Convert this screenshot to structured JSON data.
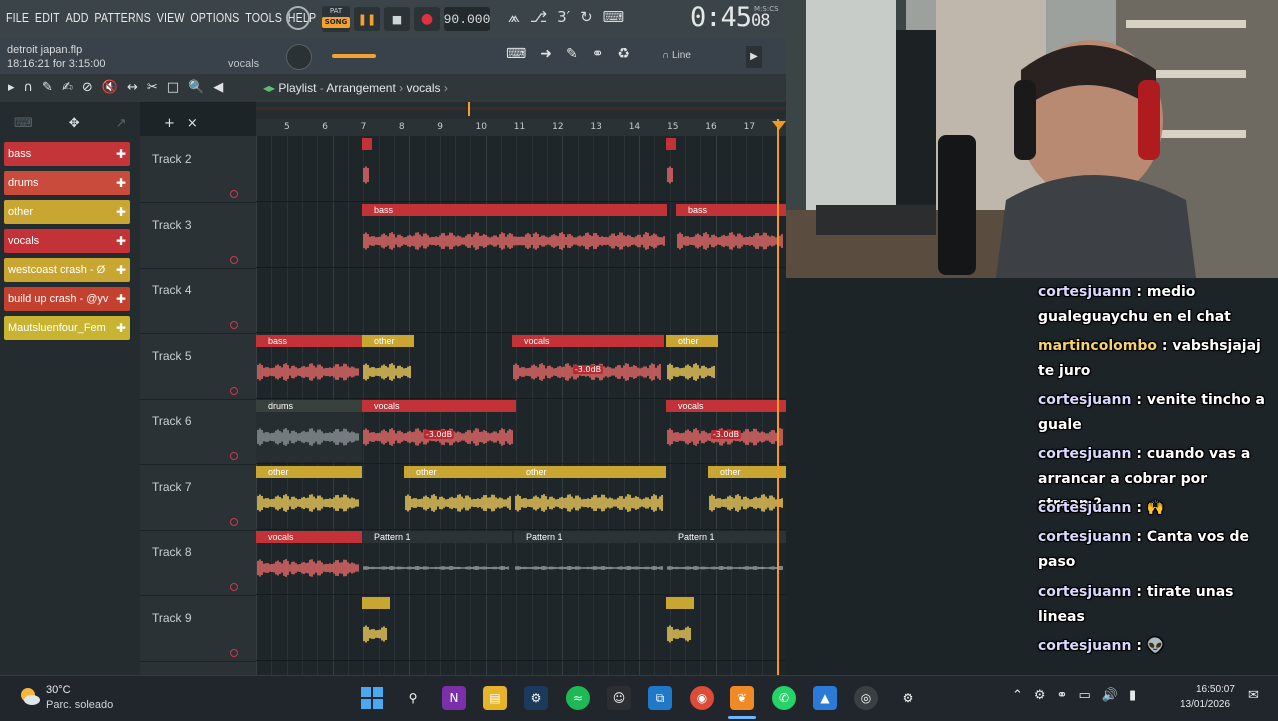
{
  "menu": [
    "FILE",
    "EDIT",
    "ADD",
    "PATTERNS",
    "VIEW",
    "OPTIONS",
    "TOOLS",
    "HELP"
  ],
  "transport": {
    "mode_pat": "PAT",
    "mode_song": "SONG",
    "tempo": "90.000",
    "time_main": "0:45",
    "time_sub": "08",
    "time_unit": "M:S:CS"
  },
  "file_info": {
    "project_name": "detroit japan.flp",
    "time_info": "18:16:21 for 3:15:00",
    "hint": "vocals"
  },
  "snap": "Line",
  "breadcrumb": {
    "root": "Playlist",
    "section": "Arrangement",
    "current": "vocals"
  },
  "clip_picker": [
    {
      "label": "bass",
      "color": "#c4353a"
    },
    {
      "label": "drums",
      "color": "#c94b3b"
    },
    {
      "label": "other",
      "color": "#c9a632"
    },
    {
      "label": "vocals",
      "color": "#c23236"
    },
    {
      "label": "westcoast crash - Ø",
      "color": "#c9a632"
    },
    {
      "label": "build up crash - @yv",
      "color": "#c4412f"
    },
    {
      "label": "Mautsluenfour_Fem",
      "color": "#c9b431"
    }
  ],
  "tracks": [
    "Track 2",
    "Track 3",
    "Track 4",
    "Track 5",
    "Track 6",
    "Track 7",
    "Track 8",
    "Track 9"
  ],
  "ruler": [
    "5",
    "6",
    "7",
    "8",
    "9",
    "10",
    "11",
    "12",
    "13",
    "14",
    "15",
    "16",
    "17"
  ],
  "clip_labels": {
    "bass": "bass",
    "other": "other",
    "vocals": "vocals",
    "drums": "drums",
    "pattern": "Pattern 1",
    "db": "-3.0dB"
  },
  "chat": [
    {
      "user": "cortesjuann",
      "msg": "medio gualeguaychu en el chat"
    },
    {
      "user": "martincolombo",
      "msg": "vabshsjajaj te juro"
    },
    {
      "user": "cortesjuann",
      "msg": "venite tincho a guale"
    },
    {
      "user": "cortesjuann",
      "msg": "cuando vas a arrancar a cobrar por stream?"
    },
    {
      "user": "cortesjuann",
      "msg": "🙌"
    },
    {
      "user": "cortesjuann",
      "msg": "Canta vos de paso"
    },
    {
      "user": "cortesjuann",
      "msg": "tirate unas lineas"
    },
    {
      "user": "cortesjuann",
      "msg": "👽"
    }
  ],
  "taskbar": {
    "weather_temp": "30°C",
    "weather_desc": "Parc. soleado",
    "clock_time": "16:50:07",
    "clock_date": "13/01/2026"
  },
  "colors": {
    "red_clip": "#c23236",
    "gold_clip": "#c9a632",
    "playhead": "#f39a1e"
  }
}
